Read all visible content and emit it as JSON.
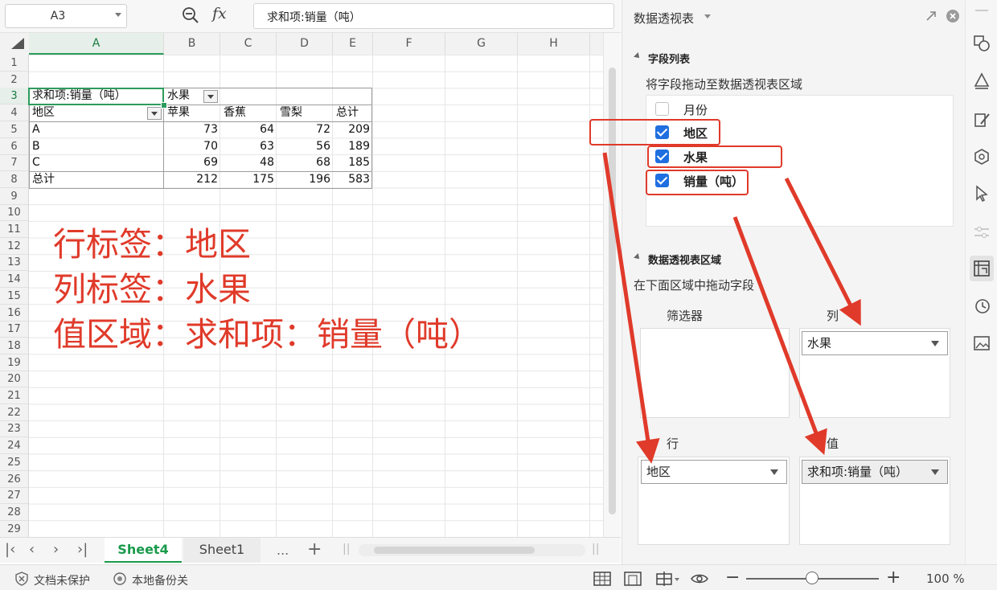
{
  "formula_bar": {
    "name_box": "A3",
    "formula_text": "求和项:销量（吨）"
  },
  "columns": [
    "A",
    "B",
    "C",
    "D",
    "E",
    "F",
    "G",
    "H"
  ],
  "rows": [
    "1",
    "2",
    "3",
    "4",
    "5",
    "6",
    "7",
    "8",
    "9",
    "10",
    "11",
    "12",
    "13",
    "14",
    "15",
    "16",
    "17",
    "18",
    "19",
    "20",
    "21",
    "22",
    "23",
    "24",
    "25",
    "26",
    "27",
    "28",
    "29"
  ],
  "pivot": {
    "value_header": "求和项:销量（吨）",
    "col_field": "水果",
    "row_field": "地区",
    "col_items": [
      "苹果",
      "香蕉",
      "雪梨",
      "总计"
    ],
    "data_rows": [
      {
        "label": "A",
        "values": [
          "73",
          "64",
          "72",
          "209"
        ]
      },
      {
        "label": "B",
        "values": [
          "70",
          "63",
          "56",
          "189"
        ]
      },
      {
        "label": "C",
        "values": [
          "69",
          "48",
          "68",
          "185"
        ]
      },
      {
        "label": "总计",
        "values": [
          "212",
          "175",
          "196",
          "583"
        ]
      }
    ]
  },
  "annotation": {
    "line1": "行标签：地区",
    "line2": "列标签：水果",
    "line3": "值区域：求和项：销量（吨）"
  },
  "sheet_tabs": {
    "active": "Sheet4",
    "other": "Sheet1",
    "more": "...",
    "add": "+"
  },
  "status_bar": {
    "protect": "文档未保护",
    "backup": "本地备份关",
    "zoom": "100 %"
  },
  "pane": {
    "title": "数据透视表",
    "field_list_title": "字段列表",
    "field_list_hint": "将字段拖动至数据透视表区域",
    "fields": [
      {
        "label": "月份",
        "checked": false
      },
      {
        "label": "地区",
        "checked": true
      },
      {
        "label": "水果",
        "checked": true
      },
      {
        "label": "销量（吨）",
        "checked": true
      }
    ],
    "areas_title": "数据透视表区域",
    "areas_hint": "在下面区域中拖动字段",
    "filter_label": "筛选器",
    "column_label": "列",
    "row_label": "行",
    "value_label": "值",
    "column_field": "水果",
    "row_field": "地区",
    "value_field": "求和项:销量（吨）"
  },
  "colors": {
    "accent_green": "#1a9a4c",
    "annotation_red": "#e03a2a",
    "checkbox_blue": "#1f6fe0"
  }
}
